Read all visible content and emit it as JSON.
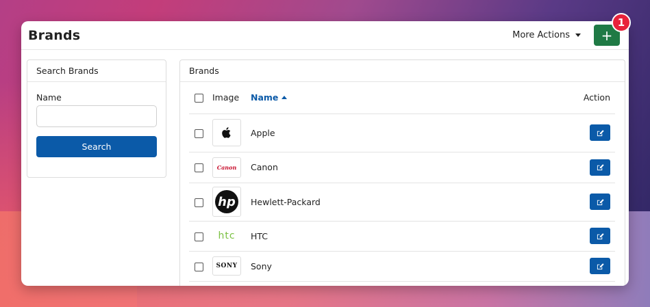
{
  "header": {
    "title": "Brands",
    "more_actions_label": "More Actions",
    "add_button_label": "+",
    "notification_count": "1"
  },
  "search": {
    "panel_title": "Search Brands",
    "name_label": "Name",
    "name_value": "",
    "name_placeholder": "",
    "search_button_label": "Search"
  },
  "brands": {
    "panel_title": "Brands",
    "columns": {
      "image": "Image",
      "name": "Name",
      "action": "Action"
    },
    "sort": {
      "column": "name",
      "direction": "ascending"
    },
    "rows": [
      {
        "name": "Apple",
        "logo_icon": "apple-logo-icon"
      },
      {
        "name": "Canon",
        "logo_icon": "canon-logo-icon",
        "logo_text": "Canon"
      },
      {
        "name": "Hewlett-Packard",
        "logo_icon": "hp-logo-icon",
        "logo_text": "hp"
      },
      {
        "name": "HTC",
        "logo_icon": "htc-logo-icon",
        "logo_text": "htc"
      },
      {
        "name": "Sony",
        "logo_icon": "sony-logo-icon",
        "logo_text": "SONY"
      }
    ]
  },
  "colors": {
    "primary": "#0b5aa8",
    "add_button": "#1f7a45",
    "badge": "#e8223a",
    "canon_red": "#c8102e",
    "htc_green": "#7bc142"
  }
}
